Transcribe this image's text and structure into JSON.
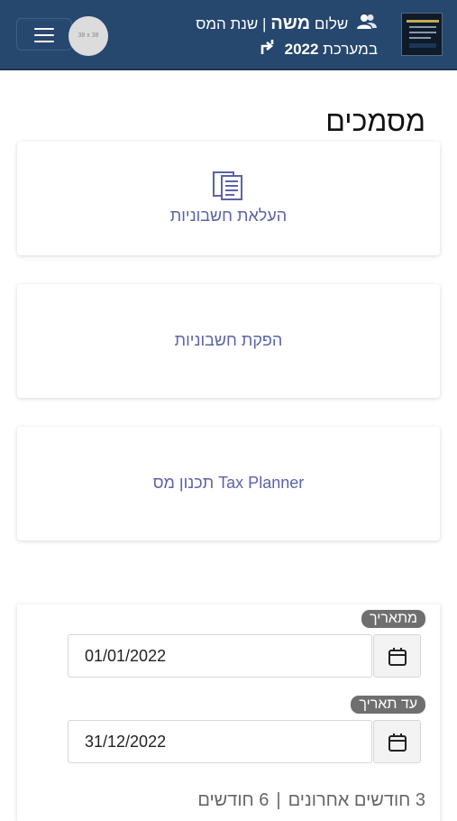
{
  "header": {
    "greeting_prefix": "שלום",
    "user_name": "משה",
    "separator": "|",
    "tax_year_label": "שנת המס",
    "system_prefix": "במערכת",
    "tax_year": "2022",
    "avatar_text": "38 x 38",
    "background_color": "#26476e"
  },
  "page_title": "מסמכים",
  "cards": [
    {
      "label": "העלאת חשבוניות",
      "icon": "documents-icon"
    },
    {
      "label": "הפקת חשבוניות"
    },
    {
      "label": "Tax Planner תכנון מס"
    }
  ],
  "date_filter": {
    "from_label": "מתאריך",
    "from_value": "01/01/2022",
    "to_label": "עד תאריך",
    "to_value": "31/12/2022",
    "range_links": [
      "3 חודשים אחרונים",
      "6 חודשים"
    ],
    "range_separator": "|"
  },
  "colors": {
    "accent_text": "#5b63a8",
    "label_badge": "#6f6f6f"
  }
}
